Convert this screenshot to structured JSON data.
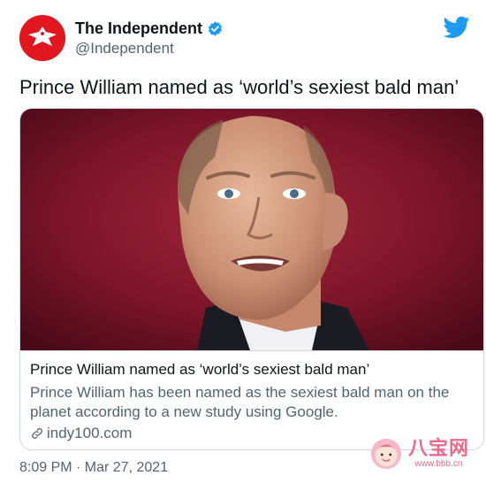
{
  "account": {
    "display_name": "The Independent",
    "handle": "@Independent",
    "verified": true
  },
  "tweet": {
    "text": "Prince William named as ‘world’s sexiest bald man’",
    "timestamp": "8:09 PM · Mar 27, 2021"
  },
  "card": {
    "title": "Prince William named as ‘world’s sexiest bald man’",
    "description": "Prince William has been named as the sexiest bald man on the planet according to a new study using Google.",
    "link_domain": "indy100.com"
  },
  "watermark": {
    "brand_cn": "八宝网",
    "url": "www.bbb.cn"
  },
  "colors": {
    "brand_red": "#e1161e",
    "twitter_blue": "#1d9bf0",
    "muted_text": "#536471",
    "watermark_pink": "#ee6a8c"
  }
}
